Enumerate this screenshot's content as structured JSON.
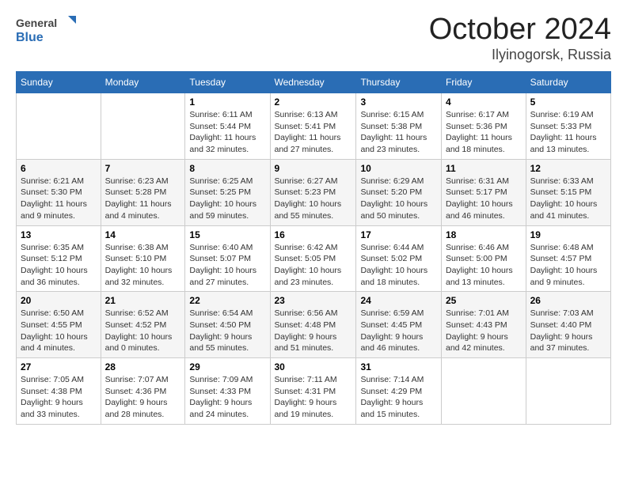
{
  "header": {
    "logo_general": "General",
    "logo_blue": "Blue",
    "month_title": "October 2024",
    "location": "Ilyinogorsk, Russia"
  },
  "weekdays": [
    "Sunday",
    "Monday",
    "Tuesday",
    "Wednesday",
    "Thursday",
    "Friday",
    "Saturday"
  ],
  "weeks": [
    [
      {
        "day": "",
        "text": ""
      },
      {
        "day": "",
        "text": ""
      },
      {
        "day": "1",
        "text": "Sunrise: 6:11 AM\nSunset: 5:44 PM\nDaylight: 11 hours and 32 minutes."
      },
      {
        "day": "2",
        "text": "Sunrise: 6:13 AM\nSunset: 5:41 PM\nDaylight: 11 hours and 27 minutes."
      },
      {
        "day": "3",
        "text": "Sunrise: 6:15 AM\nSunset: 5:38 PM\nDaylight: 11 hours and 23 minutes."
      },
      {
        "day": "4",
        "text": "Sunrise: 6:17 AM\nSunset: 5:36 PM\nDaylight: 11 hours and 18 minutes."
      },
      {
        "day": "5",
        "text": "Sunrise: 6:19 AM\nSunset: 5:33 PM\nDaylight: 11 hours and 13 minutes."
      }
    ],
    [
      {
        "day": "6",
        "text": "Sunrise: 6:21 AM\nSunset: 5:30 PM\nDaylight: 11 hours and 9 minutes."
      },
      {
        "day": "7",
        "text": "Sunrise: 6:23 AM\nSunset: 5:28 PM\nDaylight: 11 hours and 4 minutes."
      },
      {
        "day": "8",
        "text": "Sunrise: 6:25 AM\nSunset: 5:25 PM\nDaylight: 10 hours and 59 minutes."
      },
      {
        "day": "9",
        "text": "Sunrise: 6:27 AM\nSunset: 5:23 PM\nDaylight: 10 hours and 55 minutes."
      },
      {
        "day": "10",
        "text": "Sunrise: 6:29 AM\nSunset: 5:20 PM\nDaylight: 10 hours and 50 minutes."
      },
      {
        "day": "11",
        "text": "Sunrise: 6:31 AM\nSunset: 5:17 PM\nDaylight: 10 hours and 46 minutes."
      },
      {
        "day": "12",
        "text": "Sunrise: 6:33 AM\nSunset: 5:15 PM\nDaylight: 10 hours and 41 minutes."
      }
    ],
    [
      {
        "day": "13",
        "text": "Sunrise: 6:35 AM\nSunset: 5:12 PM\nDaylight: 10 hours and 36 minutes."
      },
      {
        "day": "14",
        "text": "Sunrise: 6:38 AM\nSunset: 5:10 PM\nDaylight: 10 hours and 32 minutes."
      },
      {
        "day": "15",
        "text": "Sunrise: 6:40 AM\nSunset: 5:07 PM\nDaylight: 10 hours and 27 minutes."
      },
      {
        "day": "16",
        "text": "Sunrise: 6:42 AM\nSunset: 5:05 PM\nDaylight: 10 hours and 23 minutes."
      },
      {
        "day": "17",
        "text": "Sunrise: 6:44 AM\nSunset: 5:02 PM\nDaylight: 10 hours and 18 minutes."
      },
      {
        "day": "18",
        "text": "Sunrise: 6:46 AM\nSunset: 5:00 PM\nDaylight: 10 hours and 13 minutes."
      },
      {
        "day": "19",
        "text": "Sunrise: 6:48 AM\nSunset: 4:57 PM\nDaylight: 10 hours and 9 minutes."
      }
    ],
    [
      {
        "day": "20",
        "text": "Sunrise: 6:50 AM\nSunset: 4:55 PM\nDaylight: 10 hours and 4 minutes."
      },
      {
        "day": "21",
        "text": "Sunrise: 6:52 AM\nSunset: 4:52 PM\nDaylight: 10 hours and 0 minutes."
      },
      {
        "day": "22",
        "text": "Sunrise: 6:54 AM\nSunset: 4:50 PM\nDaylight: 9 hours and 55 minutes."
      },
      {
        "day": "23",
        "text": "Sunrise: 6:56 AM\nSunset: 4:48 PM\nDaylight: 9 hours and 51 minutes."
      },
      {
        "day": "24",
        "text": "Sunrise: 6:59 AM\nSunset: 4:45 PM\nDaylight: 9 hours and 46 minutes."
      },
      {
        "day": "25",
        "text": "Sunrise: 7:01 AM\nSunset: 4:43 PM\nDaylight: 9 hours and 42 minutes."
      },
      {
        "day": "26",
        "text": "Sunrise: 7:03 AM\nSunset: 4:40 PM\nDaylight: 9 hours and 37 minutes."
      }
    ],
    [
      {
        "day": "27",
        "text": "Sunrise: 7:05 AM\nSunset: 4:38 PM\nDaylight: 9 hours and 33 minutes."
      },
      {
        "day": "28",
        "text": "Sunrise: 7:07 AM\nSunset: 4:36 PM\nDaylight: 9 hours and 28 minutes."
      },
      {
        "day": "29",
        "text": "Sunrise: 7:09 AM\nSunset: 4:33 PM\nDaylight: 9 hours and 24 minutes."
      },
      {
        "day": "30",
        "text": "Sunrise: 7:11 AM\nSunset: 4:31 PM\nDaylight: 9 hours and 19 minutes."
      },
      {
        "day": "31",
        "text": "Sunrise: 7:14 AM\nSunset: 4:29 PM\nDaylight: 9 hours and 15 minutes."
      },
      {
        "day": "",
        "text": ""
      },
      {
        "day": "",
        "text": ""
      }
    ]
  ]
}
